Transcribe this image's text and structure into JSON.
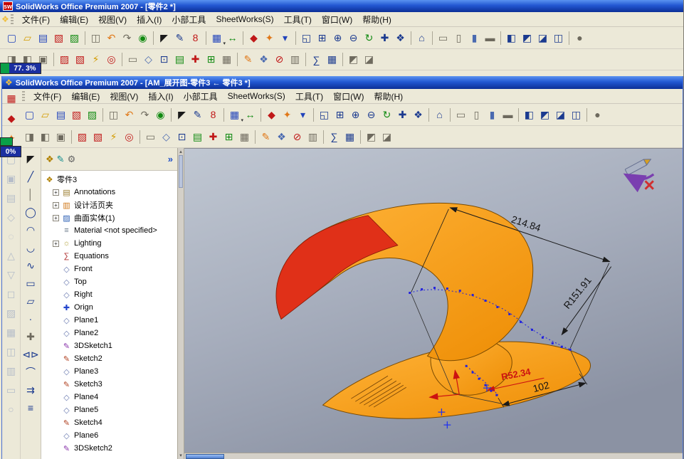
{
  "outer": {
    "title": "SolidWorks Office Premium 2007 - [零件2 *]",
    "progress": "77. 3%"
  },
  "inner": {
    "title": "SolidWorks Office Premium 2007 - [AM_展开图-零件3 ← 零件3 *]",
    "progress": "0%"
  },
  "menus": [
    "文件(F)",
    "编辑(E)",
    "视图(V)",
    "插入(I)",
    "小部工具",
    "SheetWorks(S)",
    "工具(T)",
    "窗口(W)",
    "帮助(H)"
  ],
  "icons": {
    "sw_logo": "sw",
    "child_part": "❖",
    "tab_feature": "❖",
    "tab_property": "✎",
    "tab_config": "⚙",
    "cancel": "×"
  },
  "colors": {
    "model_orange": "#f59a23",
    "model_red": "#e03018",
    "dimension_red": "#cc1111",
    "sketch_blue": "#2222dd",
    "titlebar_blue": "#2257d2",
    "progress_green": "#0aa048",
    "progress_blue": "#1b2fa0"
  },
  "dims": {
    "width": "214.84",
    "radius_large": "R151.91",
    "radius_small": "R52.34",
    "length": "102"
  },
  "tree": {
    "tabs_more": "»",
    "items": [
      {
        "label": "零件3",
        "icon": "part-icon",
        "g": "❖",
        "c": "#b08000"
      },
      {
        "label": "Annotations",
        "icon": "annotations-icon",
        "g": "▤",
        "c": "#9a7b2d",
        "expand": "+"
      },
      {
        "label": "设计活页夹",
        "icon": "design-binder-icon",
        "g": "▥",
        "c": "#d07818",
        "expand": "+"
      },
      {
        "label": "曲面实体(1)",
        "icon": "surface-bodies-folder-icon",
        "g": "▨",
        "c": "#2b5fb4",
        "expand": "+"
      },
      {
        "label": "Material <not specified>",
        "icon": "material-icon",
        "g": "≡",
        "c": "#6a7a8a"
      },
      {
        "label": "Lighting",
        "icon": "lighting-icon",
        "g": "☼",
        "c": "#b5a642",
        "expand": "+"
      },
      {
        "label": "Equations",
        "icon": "equations-icon",
        "g": "∑",
        "c": "#b03030"
      },
      {
        "label": "Front",
        "icon": "plane-icon",
        "g": "◇",
        "c": "#6a7ab0"
      },
      {
        "label": "Top",
        "icon": "plane-icon",
        "g": "◇",
        "c": "#6a7ab0"
      },
      {
        "label": "Right",
        "icon": "plane-icon",
        "g": "◇",
        "c": "#6a7ab0"
      },
      {
        "label": "Orign",
        "icon": "origin-icon",
        "g": "✚",
        "c": "#2244cc"
      },
      {
        "label": "Plane1",
        "icon": "plane-icon",
        "g": "◇",
        "c": "#6a7ab0"
      },
      {
        "label": "Plane2",
        "icon": "plane-icon",
        "g": "◇",
        "c": "#6a7ab0"
      },
      {
        "label": "3DSketch1",
        "icon": "3d-sketch-icon",
        "g": "✎",
        "c": "#8833aa"
      },
      {
        "label": "Sketch2",
        "icon": "sketch-icon",
        "g": "✎",
        "c": "#b04020"
      },
      {
        "label": "Plane3",
        "icon": "plane-icon",
        "g": "◇",
        "c": "#6a7ab0"
      },
      {
        "label": "Sketch3",
        "icon": "sketch-icon",
        "g": "✎",
        "c": "#b04020"
      },
      {
        "label": "Plane4",
        "icon": "plane-icon",
        "g": "◇",
        "c": "#6a7ab0"
      },
      {
        "label": "Plane5",
        "icon": "plane-icon",
        "g": "◇",
        "c": "#6a7ab0"
      },
      {
        "label": "Sketch4",
        "icon": "sketch-icon",
        "g": "✎",
        "c": "#b04020"
      },
      {
        "label": "Plane6",
        "icon": "plane-icon",
        "g": "◇",
        "c": "#6a7ab0"
      },
      {
        "label": "3DSketch2",
        "icon": "3d-sketch-icon",
        "g": "✎",
        "c": "#8833aa"
      }
    ]
  },
  "toolbars": {
    "row1": [
      {
        "n": "new-document",
        "g": "▢",
        "c": "cBlue"
      },
      {
        "n": "open-document",
        "g": "▱",
        "c": "cYellow"
      },
      {
        "n": "save",
        "g": "▤",
        "c": "cBlue"
      },
      {
        "n": "make-drawing",
        "g": "▧",
        "c": "cRed"
      },
      {
        "n": "make-assembly",
        "g": "▨",
        "c": "cGreen"
      },
      {
        "sep": true
      },
      {
        "n": "print",
        "g": "◫",
        "c": "cGray"
      },
      {
        "n": "undo",
        "g": "↶",
        "c": "cOrange"
      },
      {
        "n": "redo",
        "g": "↷",
        "c": "cGray"
      },
      {
        "n": "rebuild",
        "g": "◉",
        "c": "cGreen"
      },
      {
        "sep": true
      },
      {
        "n": "select",
        "g": "◤",
        "c": "cBlack"
      },
      {
        "n": "sketch",
        "g": "✎",
        "c": "cNavy"
      },
      {
        "n": "tool-8",
        "g": "8",
        "c": "cRed"
      },
      {
        "sep": true
      },
      {
        "n": "grid",
        "g": "▦",
        "c": "cBlue",
        "dd": true
      },
      {
        "n": "dimension",
        "g": "↔",
        "c": "cGreen"
      },
      {
        "sep": true
      },
      {
        "n": "feature-diamond",
        "g": "◆",
        "c": "cRed"
      },
      {
        "n": "feature-star",
        "g": "✦",
        "c": "cOrange"
      },
      {
        "n": "view-drop",
        "g": "▾",
        "c": "cBlue"
      },
      {
        "sep": true
      },
      {
        "n": "zoom-fit",
        "g": "◱",
        "c": "cNavy"
      },
      {
        "n": "zoom-area",
        "g": "⊞",
        "c": "cNavy"
      },
      {
        "n": "zoom-in-out",
        "g": "⊕",
        "c": "cNavy"
      },
      {
        "n": "zoom-selection",
        "g": "⊖",
        "c": "cNavy"
      },
      {
        "n": "rotate-view",
        "g": "↻",
        "c": "cGreen"
      },
      {
        "n": "pan",
        "g": "✚",
        "c": "cNavy"
      },
      {
        "n": "3d-drag",
        "g": "❖",
        "c": "cNavy"
      },
      {
        "sep": true
      },
      {
        "n": "view-orientation",
        "g": "⌂",
        "c": "cNavy"
      },
      {
        "sep": true
      },
      {
        "n": "wireframe",
        "g": "▭",
        "c": "cGray"
      },
      {
        "n": "hidden-lines-visible",
        "g": "▯",
        "c": "cGray"
      },
      {
        "n": "shaded-with-edges",
        "g": "▮",
        "c": "cSteel"
      },
      {
        "n": "shadows",
        "g": "▬",
        "c": "cGray"
      },
      {
        "sep": true
      },
      {
        "n": "view-front",
        "g": "◧",
        "c": "cNavy"
      },
      {
        "n": "view-top",
        "g": "◩",
        "c": "cNavy"
      },
      {
        "n": "view-iso",
        "g": "◪",
        "c": "cNavy"
      },
      {
        "n": "view-four-pane",
        "g": "◫",
        "c": "cNavy"
      },
      {
        "sep": true
      },
      {
        "n": "toolbar-options",
        "g": "●",
        "c": "cGray"
      }
    ],
    "row2": [
      {
        "n": "detailing",
        "g": "◨",
        "c": "cGray"
      },
      {
        "n": "annotation-note",
        "g": "◧",
        "c": "cGray"
      },
      {
        "n": "balloon",
        "g": "▣",
        "c": "cGray"
      },
      {
        "sep": true
      },
      {
        "n": "weldment-red",
        "g": "▨",
        "c": "cRed"
      },
      {
        "n": "hatch-red",
        "g": "▧",
        "c": "cRed"
      },
      {
        "n": "lightning-tool",
        "g": "⚡",
        "c": "cYellow"
      },
      {
        "n": "target-tool",
        "g": "◎",
        "c": "cRed"
      },
      {
        "sep": true
      },
      {
        "n": "rectangle-tool",
        "g": "▭",
        "c": "cGray"
      },
      {
        "n": "plane-tool",
        "g": "◇",
        "c": "cSteel"
      },
      {
        "n": "point-tool",
        "g": "⊡",
        "c": "cNavy"
      },
      {
        "n": "table-tool",
        "g": "▤",
        "c": "cGreen"
      },
      {
        "n": "cross-tool",
        "g": "✚",
        "c": "cRed"
      },
      {
        "n": "grid-tool",
        "g": "⊞",
        "c": "cGreen"
      },
      {
        "n": "cells-tool",
        "g": "▦",
        "c": "cGray"
      },
      {
        "sep": true
      },
      {
        "n": "pencil-tool",
        "g": "✎",
        "c": "cOrange"
      },
      {
        "n": "navigate-tool",
        "g": "❖",
        "c": "cSteel"
      },
      {
        "n": "disable-tool",
        "g": "⊘",
        "c": "cRed"
      },
      {
        "n": "layers-tool",
        "g": "▥",
        "c": "cGray"
      },
      {
        "sep": true
      },
      {
        "n": "equations-tool",
        "g": "∑",
        "c": "cNavy"
      },
      {
        "n": "design-table",
        "g": "▦",
        "c": "cNavy"
      },
      {
        "sep": true
      },
      {
        "n": "camera-a",
        "g": "◩",
        "c": "cGray"
      },
      {
        "n": "camera-b",
        "g": "◪",
        "c": "cGray"
      }
    ],
    "sketch_col": [
      {
        "n": "select-arrow",
        "g": "◤",
        "c": "cBlack"
      },
      {
        "n": "line-tool",
        "g": "╱",
        "c": "cNavy"
      },
      {
        "n": "centerline-tool",
        "g": "│",
        "c": "cGray"
      },
      {
        "n": "circle-tool",
        "g": "◯",
        "c": "cNavy"
      },
      {
        "n": "arc-tool",
        "g": "◠",
        "c": "cNavy"
      },
      {
        "n": "tangent-arc-tool",
        "g": "◡",
        "c": "cNavy"
      },
      {
        "n": "spline-tool",
        "g": "∿",
        "c": "cNavy"
      },
      {
        "n": "rectangle-sketch-tool",
        "g": "▭",
        "c": "cNavy"
      },
      {
        "n": "parallelogram-tool",
        "g": "▱",
        "c": "cNavy"
      },
      {
        "n": "point-sketch-tool",
        "g": "∙",
        "c": "cNavy"
      },
      {
        "n": "axis-tool",
        "g": "✚",
        "c": "cGray"
      },
      {
        "n": "mirror-entities-tool",
        "g": "⊲⊳",
        "c": "cNavy"
      },
      {
        "n": "fillet-sketch-tool",
        "g": "⌒",
        "c": "cNavy"
      },
      {
        "n": "convert-entities-tool",
        "g": "⇉",
        "c": "cNavy"
      },
      {
        "n": "offset-entities-tool",
        "g": "≡",
        "c": "cNavy"
      }
    ],
    "colA": [
      {
        "n": "surface-extrude",
        "g": "▢",
        "c": "cFaint"
      },
      {
        "n": "surface-revolve",
        "g": "▣",
        "c": "cFaint"
      },
      {
        "n": "surface-sweep",
        "g": "▤",
        "c": "cFaint"
      },
      {
        "n": "surface-loft",
        "g": "◇",
        "c": "cFaint"
      },
      {
        "n": "surface-fill",
        "g": "◌",
        "c": "cFaint"
      },
      {
        "n": "surface-offset",
        "g": "△",
        "c": "cFaint"
      },
      {
        "n": "surface-radiate",
        "g": "▽",
        "c": "cFaint"
      },
      {
        "n": "surface-knit",
        "g": "◻",
        "c": "cFaint"
      },
      {
        "n": "surface-planar",
        "g": "▨",
        "c": "cFaint"
      },
      {
        "n": "surface-extend",
        "g": "▦",
        "c": "cFaint"
      },
      {
        "n": "surface-trim",
        "g": "◫",
        "c": "cFaint"
      },
      {
        "n": "surface-untrim",
        "g": "▥",
        "c": "cFaint"
      },
      {
        "n": "surface-mid",
        "g": "▭",
        "c": "cFaint"
      },
      {
        "n": "surface-delete",
        "g": "○",
        "c": "cFaint"
      }
    ],
    "addin": [
      {
        "n": "addin-grid",
        "g": "▦",
        "c": "cRed"
      },
      {
        "n": "addin-diamond",
        "g": "◆",
        "c": "cRed"
      },
      {
        "n": "addin-star",
        "g": "✦",
        "c": "cOrange"
      }
    ]
  }
}
